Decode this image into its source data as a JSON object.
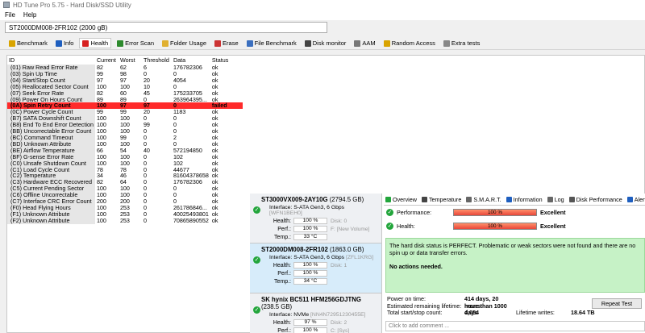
{
  "window": {
    "title": "HD Tune Pro 5.75 - Hard Disk/SSD Utility"
  },
  "menu": [
    {
      "label": "File"
    },
    {
      "label": "Help"
    }
  ],
  "drive_select": {
    "value": "ST2000DM008-2FR102 (2000 gB)"
  },
  "toolbar": [
    {
      "label": "Benchmark",
      "icon": "benchmark-icon",
      "color": "#d9a400"
    },
    {
      "label": "Info",
      "icon": "info-icon",
      "color": "#1f5fbf"
    },
    {
      "label": "Health",
      "icon": "health-icon",
      "color": "#d62020"
    },
    {
      "label": "Error Scan",
      "icon": "error-scan-icon",
      "color": "#2d8a2d"
    },
    {
      "label": "Folder Usage",
      "icon": "folder-icon",
      "color": "#e0b030"
    },
    {
      "label": "Erase",
      "icon": "erase-icon",
      "color": "#cc3333"
    },
    {
      "label": "File Benchmark",
      "icon": "file-benchmark-icon",
      "color": "#3b6fbf"
    },
    {
      "label": "Disk monitor",
      "icon": "disk-monitor-icon",
      "color": "#444444"
    },
    {
      "label": "AAM",
      "icon": "aam-icon",
      "color": "#777777"
    },
    {
      "label": "Random Access",
      "icon": "random-access-icon",
      "color": "#d9a400"
    },
    {
      "label": "Extra tests",
      "icon": "extra-tests-icon",
      "color": "#888888"
    }
  ],
  "health_table": {
    "columns": [
      "ID",
      "Current",
      "Worst",
      "Threshold",
      "Data",
      "Status"
    ],
    "rows": [
      [
        "(01) Raw Read Error Rate",
        "82",
        "62",
        "6",
        "176782306",
        "ok"
      ],
      [
        "(03) Spin Up Time",
        "99",
        "98",
        "0",
        "0",
        "ok"
      ],
      [
        "(04) Start/Stop Count",
        "97",
        "97",
        "20",
        "4054",
        "ok"
      ],
      [
        "(05) Reallocated Sector Count",
        "100",
        "100",
        "10",
        "0",
        "ok"
      ],
      [
        "(07) Seek Error Rate",
        "82",
        "60",
        "45",
        "175233705",
        "ok"
      ],
      [
        "(09) Power On Hours Count",
        "89",
        "89",
        "0",
        "263964395...",
        "ok"
      ],
      [
        "(0A) Spin Retry Count",
        "100",
        "97",
        "97",
        "0",
        "failed"
      ],
      [
        "(0C) Power Cycle Count",
        "99",
        "99",
        "20",
        "1183",
        "ok"
      ],
      [
        "(B7) SATA Downshift Count",
        "100",
        "100",
        "0",
        "0",
        "ok"
      ],
      [
        "(B8) End To End Error Detection",
        "100",
        "100",
        "99",
        "0",
        "ok"
      ],
      [
        "(BB) Uncorrectable Error Count",
        "100",
        "100",
        "0",
        "0",
        "ok"
      ],
      [
        "(BC) Command Timeout",
        "100",
        "99",
        "0",
        "2",
        "ok"
      ],
      [
        "(BD) Unknown Attribute",
        "100",
        "100",
        "0",
        "0",
        "ok"
      ],
      [
        "(BE) Airflow Temperature",
        "66",
        "54",
        "40",
        "572194850",
        "ok"
      ],
      [
        "(BF) G-sense Error Rate",
        "100",
        "100",
        "0",
        "102",
        "ok"
      ],
      [
        "(C0) Unsafe Shutdown Count",
        "100",
        "100",
        "0",
        "102",
        "ok"
      ],
      [
        "(C1) Load Cycle Count",
        "78",
        "78",
        "0",
        "44677",
        "ok"
      ],
      [
        "(C2) Temperature",
        "34",
        "46",
        "0",
        "81604378658",
        "ok"
      ],
      [
        "(C3) Hardware ECC Recovered",
        "82",
        "64",
        "0",
        "176782306",
        "ok"
      ],
      [
        "(C5) Current Pending Sector",
        "100",
        "100",
        "0",
        "0",
        "ok"
      ],
      [
        "(C6) Offline Uncorrectable",
        "100",
        "100",
        "0",
        "0",
        "ok"
      ],
      [
        "(C7) Interface CRC Error Count",
        "200",
        "200",
        "0",
        "0",
        "ok"
      ],
      [
        "(F0) Head Flying Hours",
        "100",
        "253",
        "0",
        "261786846...",
        "ok"
      ],
      [
        "(F1) Unknown Attribute",
        "100",
        "253",
        "0",
        "40025493801",
        "ok"
      ],
      [
        "(F2) Unknown Attribute",
        "100",
        "253",
        "0",
        "70865890552",
        "ok"
      ]
    ]
  },
  "drives": [
    {
      "name": "ST3000VX009-2AY10G",
      "size": "(2794.5 GB)",
      "interface_label": "Interface:",
      "interface": "S-ATA Gen3, 6 Gbps",
      "serial": "[WFN1BEH0]",
      "health_label": "Health:",
      "health": "100 %",
      "disk_label": "Disk: 0",
      "perf_label": "Perf.:",
      "perf": "100 %",
      "volume": "F: [New Volume]",
      "temp_label": "Temp.:",
      "temp": "33 °C",
      "selected": false
    },
    {
      "name": "ST2000DM008-2FR102",
      "size": "(1863.0 GB)",
      "interface_label": "Interface:",
      "interface": "S-ATA Gen3, 6 Gbps",
      "serial": "[ZFL1KRG]",
      "health_label": "Health:",
      "health": "100 %",
      "disk_label": "Disk: 1",
      "perf_label": "Perf.:",
      "perf": "100 %",
      "volume": "",
      "temp_label": "Temp.:",
      "temp": "34 °C",
      "selected": true
    },
    {
      "name": "SK hynix BC511 HFM256GDJTNG",
      "size": "(238.5 GB)",
      "interface_label": "Interface:",
      "interface": "NVMe",
      "serial": "[NN4N72951230455E]",
      "health_label": "Health:",
      "health": "97 %",
      "disk_label": "Disk: 2",
      "perf_label": "Perf.:",
      "perf": "100 %",
      "volume": "C: [Sys]",
      "temp_label": "Temp.:",
      "temp": "",
      "selected": false
    }
  ],
  "detail_tabs": [
    {
      "label": "Overview",
      "icon": "overview-icon",
      "color": "#22a53b"
    },
    {
      "label": "Temperature",
      "icon": "temperature-icon",
      "color": "#444444"
    },
    {
      "label": "S.M.A.R.T.",
      "icon": "smart-icon",
      "color": "#666666"
    },
    {
      "label": "Information",
      "icon": "information-icon",
      "color": "#1f5fbf"
    },
    {
      "label": "Log",
      "icon": "log-icon",
      "color": "#666666"
    },
    {
      "label": "Disk Performance",
      "icon": "disk-performance-icon",
      "color": "#555555"
    },
    {
      "label": "Alerts",
      "icon": "alerts-icon",
      "color": "#1f5fbf"
    }
  ],
  "performance": {
    "label": "Performance:",
    "value": "100 %",
    "percent": 100,
    "rating": "Excellent"
  },
  "health": {
    "label": "Health:",
    "value": "100 %",
    "percent": 100,
    "rating": "Excellent"
  },
  "status": {
    "message": "The hard disk status is PERFECT. Problematic or weak sectors were not found and there are no spin up or data transfer errors.",
    "actions": "No actions needed."
  },
  "info": {
    "power_on_label": "Power on time:",
    "power_on_value": "414 days, 20 hours",
    "lifetime_label": "Estimated remaining lifetime:",
    "lifetime_value": "more than 1000 days",
    "startstop_label": "Total start/stop count:",
    "startstop_value": "4,054",
    "writes_label": "Lifetime writes:",
    "writes_value": "18.64 TB"
  },
  "repeat_test": {
    "label": "Repeat Test"
  },
  "comment": {
    "placeholder": "Click to add comment ..."
  },
  "colors": {
    "failed_row": "#ff2a2a",
    "status_ok": "#c6f2c6",
    "selected_drive": "#d7ecfa"
  }
}
